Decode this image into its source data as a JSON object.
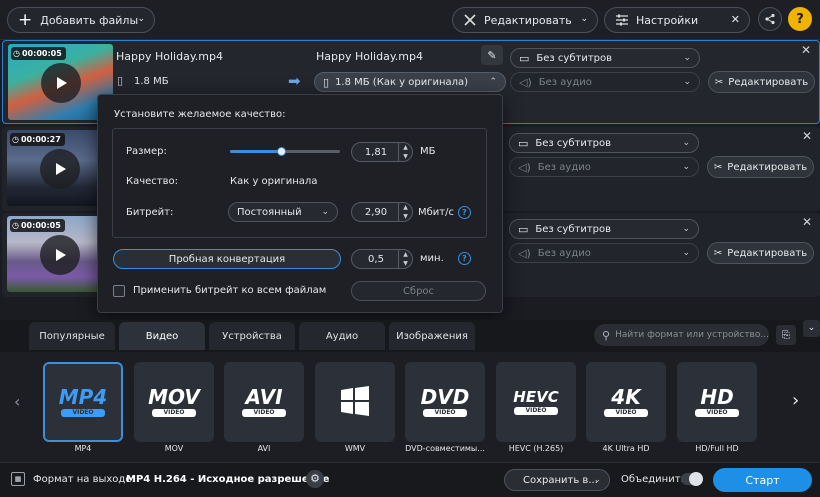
{
  "toolbar": {
    "add_files": "Добавить файлы",
    "edit": "Редактировать",
    "settings": "Настройки",
    "help": "?"
  },
  "files": [
    {
      "duration": "00:00:05",
      "name": "Happy Holiday.mp4",
      "size": "1.8 МБ",
      "output_name": "Happy Holiday.mp4",
      "output_size": "1.8 МБ (Как у оригинала)",
      "subtitles": "Без субтитров",
      "audio": "Без аудио",
      "edit": "Редактировать"
    },
    {
      "duration": "00:00:27",
      "subtitles": "Без субтитров",
      "audio": "Без аудио",
      "edit": "Редактировать"
    },
    {
      "duration": "00:00:05",
      "subtitles": "Без субтитров",
      "audio": "Без аудио",
      "edit": "Редактировать"
    }
  ],
  "quality_panel": {
    "title": "Установите желаемое качество:",
    "size_label": "Размер:",
    "size_value": "1,81",
    "size_unit": "МБ",
    "size_slider_fraction": 0.46,
    "quality_label": "Качество:",
    "quality_value": "Как у оригинала",
    "bitrate_label": "Битрейт:",
    "bitrate_mode": "Постоянный",
    "bitrate_value": "2,90",
    "bitrate_unit": "Мбит/с",
    "trial_button": "Пробная конвертация",
    "trial_minutes": "0,5",
    "trial_unit": "мин.",
    "apply_all": "Применить битрейт ко всем файлам",
    "reset": "Сброс"
  },
  "tabs": [
    "Популярные",
    "Видео",
    "Устройства",
    "Аудио",
    "Изображения"
  ],
  "active_tab": "Видео",
  "search": {
    "placeholder": "Найти формат или устройство..."
  },
  "formats": [
    {
      "logo": "MP4",
      "sub": "VIDEO",
      "label": "MP4",
      "selected": true
    },
    {
      "logo": "MOV",
      "sub": "VIDEO",
      "label": "MOV"
    },
    {
      "logo": "AVI",
      "sub": "VIDEO",
      "label": "AVI"
    },
    {
      "logo": "",
      "sub": "",
      "label": "WMV",
      "icon": "windows-icon"
    },
    {
      "logo": "DVD",
      "sub": "VIDEO",
      "label": "DVD-совместимы..."
    },
    {
      "logo": "HEVC",
      "sub": "VIDEO",
      "label": "HEVC (H.265)"
    },
    {
      "logo": "4K",
      "sub": "VIDEO",
      "label": "4K Ultra HD"
    },
    {
      "logo": "HD",
      "sub": "VIDEO",
      "label": "HD/Full HD"
    }
  ],
  "bottom": {
    "output_label": "Формат на выходе:",
    "output_value": "MP4 H.264 - Исходное разрешение",
    "save_to": "Сохранить в...",
    "merge": "Объединить:",
    "start": "Старт"
  },
  "colors": {
    "accent": "#1f8fe8",
    "selected_border": "#3d8fe0",
    "start": "#1e8fe6"
  }
}
